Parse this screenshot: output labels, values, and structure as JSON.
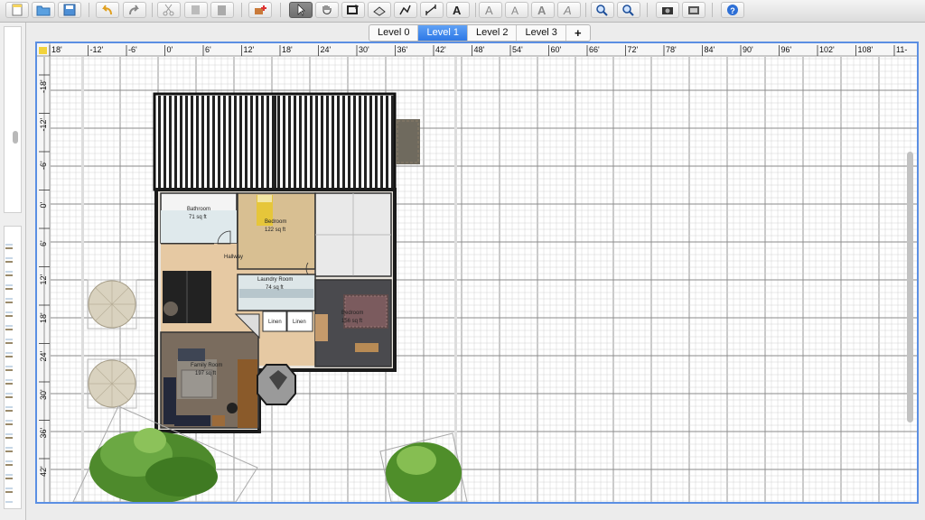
{
  "toolbar": {
    "buttons": [
      {
        "name": "new-home-button",
        "icon": "new-file-icon"
      },
      {
        "name": "open-button",
        "icon": "folder-icon"
      },
      {
        "name": "save-button",
        "icon": "save-icon"
      },
      {
        "name": "undo-button",
        "icon": "undo-icon"
      },
      {
        "name": "redo-button",
        "icon": "redo-icon"
      },
      {
        "name": "cut-button",
        "icon": "scissors-icon"
      },
      {
        "name": "copy-button",
        "icon": "copy-icon"
      },
      {
        "name": "paste-button",
        "icon": "paste-icon"
      },
      {
        "name": "add-furniture-button",
        "icon": "add-furniture-icon"
      },
      {
        "name": "select-mode-button",
        "icon": "cursor-icon"
      },
      {
        "name": "pan-mode-button",
        "icon": "hand-icon"
      },
      {
        "name": "create-walls-button",
        "icon": "wall-icon"
      },
      {
        "name": "create-rooms-button",
        "icon": "room-icon"
      },
      {
        "name": "create-polylines-button",
        "icon": "polyline-icon"
      },
      {
        "name": "create-dimensions-button",
        "icon": "dimension-icon"
      },
      {
        "name": "add-text-button",
        "icon": "text-icon"
      },
      {
        "name": "text-style-1-button",
        "icon": "text-style-icon"
      },
      {
        "name": "text-style-2-button",
        "icon": "text-style-icon"
      },
      {
        "name": "text-bold-button",
        "icon": "bold-icon"
      },
      {
        "name": "text-italic-button",
        "icon": "italic-icon"
      },
      {
        "name": "zoom-in-button",
        "icon": "zoom-in-icon"
      },
      {
        "name": "zoom-out-button",
        "icon": "zoom-out-icon"
      },
      {
        "name": "create-photo-button",
        "icon": "camera-icon"
      },
      {
        "name": "create-video-button",
        "icon": "video-icon"
      },
      {
        "name": "help-button",
        "icon": "help-icon"
      }
    ]
  },
  "levels": {
    "tabs": [
      "Level 0",
      "Level 1",
      "Level 2",
      "Level 3"
    ],
    "active": "Level 1",
    "add_label": "+"
  },
  "ruler": {
    "x_ticks": [
      "18'",
      "-12'",
      "-6'",
      "0'",
      "6'",
      "12'",
      "18'",
      "24'",
      "30'",
      "36'",
      "42'",
      "48'",
      "54'",
      "60'",
      "66'",
      "72'",
      "78'",
      "84'",
      "90'",
      "96'",
      "102'",
      "108'",
      "11-"
    ],
    "y_ticks": [
      "-18'",
      "-12'",
      "-6'",
      "0'",
      "6'",
      "12'",
      "18'",
      "24'",
      "30'",
      "36'",
      "42'"
    ]
  },
  "rooms": [
    {
      "name": "Bathroom",
      "area": "71 sq ft"
    },
    {
      "name": "Bedroom",
      "area": "122 sq ft"
    },
    {
      "name": "Hallway",
      "area": ""
    },
    {
      "name": "Laundry Room",
      "area": "74 sq ft"
    },
    {
      "name": "Linen",
      "area": ""
    },
    {
      "name": "Linen",
      "area": ""
    },
    {
      "name": "Bedroom",
      "area": "156 sq ft"
    },
    {
      "name": "Family Room",
      "area": "197 sq ft"
    }
  ],
  "colors": {
    "accent": "#2d78e6",
    "plan_border": "#5b8fe3",
    "grid": "#c8c8c8",
    "wall": "#1a1a1a"
  }
}
